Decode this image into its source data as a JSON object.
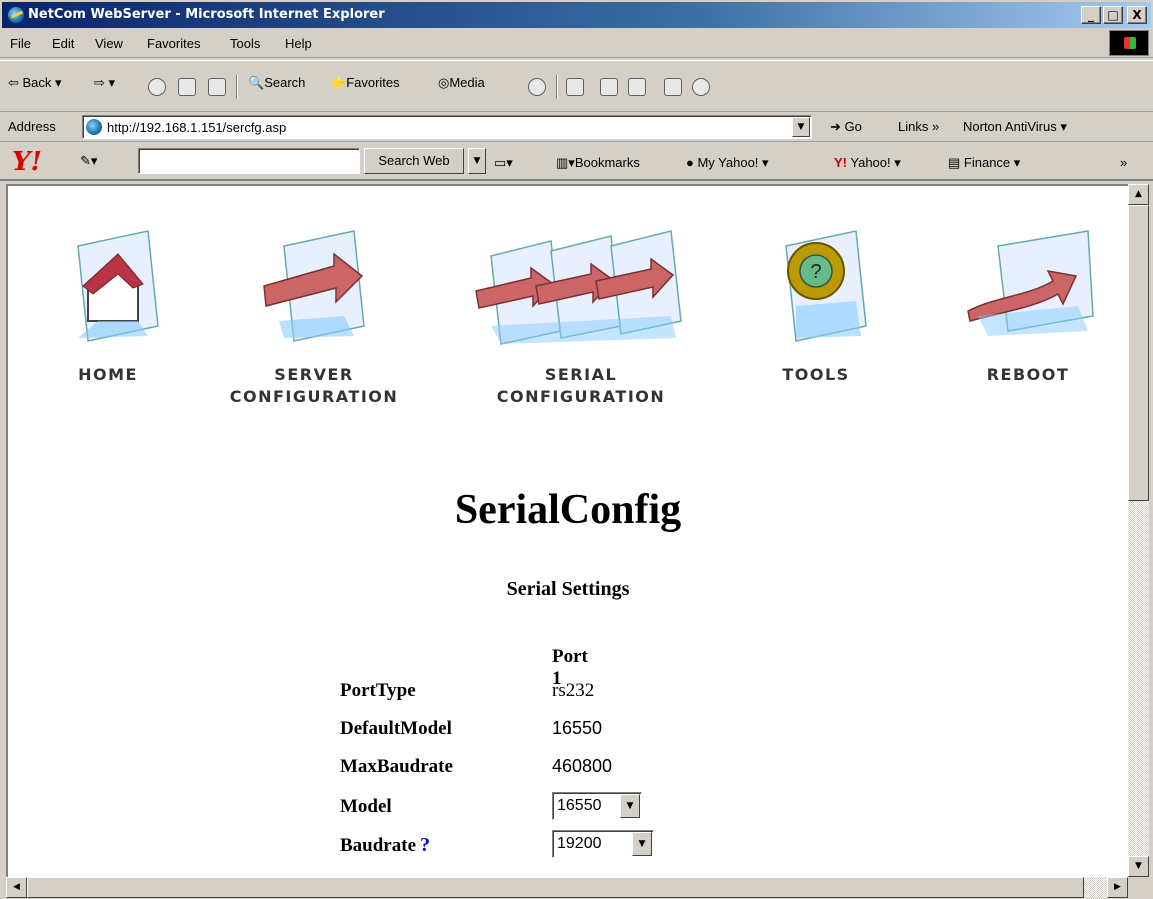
{
  "window": {
    "title": "NetCom WebServer - Microsoft Internet Explorer",
    "min": "_",
    "max": "□",
    "close": "X"
  },
  "menu": [
    "File",
    "Edit",
    "View",
    "Favorites",
    "Tools",
    "Help"
  ],
  "toolbar": {
    "back": "Back",
    "search": "Search",
    "favorites": "Favorites",
    "media": "Media"
  },
  "address": {
    "label": "Address",
    "url": "http://192.168.1.151/sercfg.asp",
    "go": "Go",
    "links": "Links",
    "norton": "Norton AntiVirus"
  },
  "yahoo": {
    "logo": "Y!",
    "search_button": "Search Web",
    "bookmarks": "Bookmarks",
    "my_yahoo": "My Yahoo!",
    "yahoo": "Yahoo!",
    "finance": "Finance",
    "more": "»"
  },
  "nav": {
    "home": "HOME",
    "server_1": "SERVER",
    "server_2": "CONFIGURATION",
    "serial_1": "SERIAL",
    "serial_2": "CONFIGURATION",
    "tools": "TOOLS",
    "reboot": "REBOOT"
  },
  "page": {
    "title": "SerialConfig",
    "section": "Serial Settings",
    "port_header": "Port 1",
    "rows": {
      "port_type": {
        "label": "PortType",
        "value": "rs232"
      },
      "default_model": {
        "label": "DefaultModel",
        "value": "16550"
      },
      "max_baudrate": {
        "label": "MaxBaudrate",
        "value": "460800"
      },
      "model": {
        "label": "Model",
        "value": "16550"
      },
      "baudrate": {
        "label": "Baudrate",
        "value": "19200",
        "help": "?"
      }
    }
  }
}
